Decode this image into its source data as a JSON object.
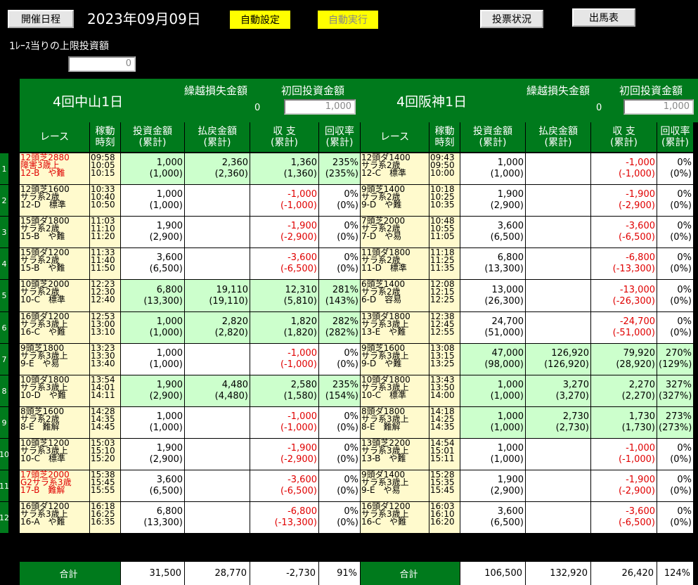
{
  "toolbar": {
    "schedule_btn": "開催日程",
    "date": "2023年09月09日",
    "auto_set": "自動設定",
    "auto_run": "自動実行",
    "vote_status": "投票状況",
    "entries": "出馬表"
  },
  "limit": {
    "label": "1ﾚｰｽ当りの上限投資額",
    "value": "0"
  },
  "venues": [
    {
      "name": "4回中山1日",
      "carry_label": "繰越損失金額",
      "carry_value": "0",
      "init_label": "初回投資金額",
      "init_value": "1,000"
    },
    {
      "name": "4回阪神1日",
      "carry_label": "繰越損失金額",
      "carry_value": "0",
      "init_label": "初回投資金額",
      "init_value": "1,000"
    }
  ],
  "columns": {
    "race": "レース",
    "time1": "稼動",
    "time2": "時刻",
    "inv1": "投資金額",
    "inv2": "(累計)",
    "pay1": "払戻金額",
    "pay2": "(累計)",
    "bal1": "収 支",
    "bal2": "(累計)",
    "rate1": "回収率",
    "rate2": "(累計)"
  },
  "rows": [
    {
      "n": "1",
      "v": [
        {
          "red": true,
          "race": [
            "12頭芝2880",
            "障害3歳上",
            "12-B　や難"
          ],
          "time": [
            "09:58",
            "10:05",
            "10:15"
          ],
          "hl": true,
          "inv": [
            "1,000",
            "(1,000)"
          ],
          "pay": [
            "2,360",
            "(2,360)"
          ],
          "bal": [
            "1,360",
            "(1,360)"
          ],
          "rate": [
            "235%",
            "(235%)"
          ],
          "neg": false
        },
        {
          "red": false,
          "race": [
            "12頭ダ1400",
            "サラ系2歳",
            "12-C　標準"
          ],
          "time": [
            "09:43",
            "09:50",
            "10:00"
          ],
          "hl": false,
          "inv": [
            "1,000",
            "(1,000)"
          ],
          "pay": [
            "",
            ""
          ],
          "bal": [
            "-1,000",
            "(-1,000)"
          ],
          "rate": [
            "0%",
            "(0%)"
          ],
          "neg": true
        }
      ]
    },
    {
      "n": "2",
      "v": [
        {
          "red": false,
          "race": [
            "12頭芝1600",
            "サラ系2歳",
            "12-D　標準"
          ],
          "time": [
            "10:33",
            "10:40",
            "10:50"
          ],
          "hl": false,
          "inv": [
            "1,000",
            "(1,000)"
          ],
          "pay": [
            "",
            ""
          ],
          "bal": [
            "-1,000",
            "(-1,000)"
          ],
          "rate": [
            "0%",
            "(0%)"
          ],
          "neg": true
        },
        {
          "red": false,
          "race": [
            "9頭芝1400",
            "サラ系2歳",
            "9-D　や難"
          ],
          "time": [
            "10:18",
            "10:25",
            "10:35"
          ],
          "hl": false,
          "inv": [
            "1,900",
            "(2,900)"
          ],
          "pay": [
            "",
            ""
          ],
          "bal": [
            "-1,900",
            "(-2,900)"
          ],
          "rate": [
            "0%",
            "(0%)"
          ],
          "neg": true
        }
      ]
    },
    {
      "n": "3",
      "v": [
        {
          "red": false,
          "race": [
            "15頭ダ1800",
            "サラ系2歳",
            "15-B　や難"
          ],
          "time": [
            "11:03",
            "11:10",
            "11:20"
          ],
          "hl": false,
          "inv": [
            "1,900",
            "(2,900)"
          ],
          "pay": [
            "",
            ""
          ],
          "bal": [
            "-1,900",
            "(-2,900)"
          ],
          "rate": [
            "0%",
            "(0%)"
          ],
          "neg": true
        },
        {
          "red": false,
          "race": [
            "7頭芝2000",
            "サラ系2歳",
            "7-D　や易"
          ],
          "time": [
            "10:48",
            "10:55",
            "11:05"
          ],
          "hl": false,
          "inv": [
            "3,600",
            "(6,500)"
          ],
          "pay": [
            "",
            ""
          ],
          "bal": [
            "-3,600",
            "(-6,500)"
          ],
          "rate": [
            "0%",
            "(0%)"
          ],
          "neg": true
        }
      ]
    },
    {
      "n": "4",
      "v": [
        {
          "red": false,
          "race": [
            "15頭ダ1200",
            "サラ系2歳",
            "15-B　や難"
          ],
          "time": [
            "11:33",
            "11:40",
            "11:50"
          ],
          "hl": false,
          "inv": [
            "3,600",
            "(6,500)"
          ],
          "pay": [
            "",
            ""
          ],
          "bal": [
            "-3,600",
            "(-6,500)"
          ],
          "rate": [
            "0%",
            "(0%)"
          ],
          "neg": true
        },
        {
          "red": false,
          "race": [
            "11頭ダ1800",
            "サラ系2歳",
            "11-D　標準"
          ],
          "time": [
            "11:18",
            "11:25",
            "11:35"
          ],
          "hl": false,
          "inv": [
            "6,800",
            "(13,300)"
          ],
          "pay": [
            "",
            ""
          ],
          "bal": [
            "-6,800",
            "(-13,300)"
          ],
          "rate": [
            "0%",
            "(0%)"
          ],
          "neg": true
        }
      ]
    },
    {
      "n": "5",
      "v": [
        {
          "red": false,
          "race": [
            "10頭芝2000",
            "サラ系2歳",
            "10-C　標準"
          ],
          "time": [
            "12:23",
            "12:30",
            "12:40"
          ],
          "hl": true,
          "inv": [
            "6,800",
            "(13,300)"
          ],
          "pay": [
            "19,110",
            "(19,110)"
          ],
          "bal": [
            "12,310",
            "(5,810)"
          ],
          "rate": [
            "281%",
            "(143%)"
          ],
          "neg": false
        },
        {
          "red": false,
          "race": [
            "6頭芝1400",
            "サラ系2歳",
            "6-D　容易"
          ],
          "time": [
            "12:08",
            "12:15",
            "12:25"
          ],
          "hl": false,
          "inv": [
            "13,000",
            "(26,300)"
          ],
          "pay": [
            "",
            ""
          ],
          "bal": [
            "-13,000",
            "(-26,300)"
          ],
          "rate": [
            "0%",
            "(0%)"
          ],
          "neg": true
        }
      ]
    },
    {
      "n": "6",
      "v": [
        {
          "red": false,
          "race": [
            "16頭ダ1200",
            "サラ系3歳上",
            "16-C　や難"
          ],
          "time": [
            "12:53",
            "13:00",
            "13:10"
          ],
          "hl": true,
          "inv": [
            "1,000",
            "(1,000)"
          ],
          "pay": [
            "2,820",
            "(2,820)"
          ],
          "bal": [
            "1,820",
            "(1,820)"
          ],
          "rate": [
            "282%",
            "(282%)"
          ],
          "neg": false
        },
        {
          "red": false,
          "race": [
            "13頭ダ1800",
            "サラ系3歳上",
            "13-E　や難"
          ],
          "time": [
            "12:38",
            "12:45",
            "12:55"
          ],
          "hl": false,
          "inv": [
            "24,700",
            "(51,000)"
          ],
          "pay": [
            "",
            ""
          ],
          "bal": [
            "-24,700",
            "(-51,000)"
          ],
          "rate": [
            "0%",
            "(0%)"
          ],
          "neg": true
        }
      ]
    },
    {
      "n": "7",
      "v": [
        {
          "red": false,
          "race": [
            "9頭芝1800",
            "サラ系3歳上",
            "9-E　や易"
          ],
          "time": [
            "13:23",
            "13:30",
            "13:40"
          ],
          "hl": false,
          "inv": [
            "1,000",
            "(1,000)"
          ],
          "pay": [
            "",
            ""
          ],
          "bal": [
            "-1,000",
            "(-1,000)"
          ],
          "rate": [
            "0%",
            "(0%)"
          ],
          "neg": true
        },
        {
          "red": false,
          "race": [
            "9頭芝1600",
            "サラ系3歳上",
            "9-D　や難"
          ],
          "time": [
            "13:08",
            "13:15",
            "13:25"
          ],
          "hl": true,
          "inv": [
            "47,000",
            "(98,000)"
          ],
          "pay": [
            "126,920",
            "(126,920)"
          ],
          "bal": [
            "79,920",
            "(28,920)"
          ],
          "rate": [
            "270%",
            "(129%)"
          ],
          "neg": false
        }
      ]
    },
    {
      "n": "8",
      "v": [
        {
          "red": false,
          "race": [
            "10頭ダ1800",
            "サラ系3歳上",
            "10-D　や難"
          ],
          "time": [
            "13:54",
            "14:01",
            "14:11"
          ],
          "hl": true,
          "inv": [
            "1,900",
            "(2,900)"
          ],
          "pay": [
            "4,480",
            "(4,480)"
          ],
          "bal": [
            "2,580",
            "(1,580)"
          ],
          "rate": [
            "235%",
            "(154%)"
          ],
          "neg": false
        },
        {
          "red": false,
          "race": [
            "10頭ダ1800",
            "サラ系3歳上",
            "10-C　標準"
          ],
          "time": [
            "13:43",
            "13:50",
            "14:00"
          ],
          "hl": true,
          "inv": [
            "1,000",
            "(1,000)"
          ],
          "pay": [
            "3,270",
            "(3,270)"
          ],
          "bal": [
            "2,270",
            "(2,270)"
          ],
          "rate": [
            "327%",
            "(327%)"
          ],
          "neg": false
        }
      ]
    },
    {
      "n": "9",
      "v": [
        {
          "red": false,
          "race": [
            "8頭芝1600",
            "サラ系2歳",
            "8-E　難解"
          ],
          "time": [
            "14:28",
            "14:35",
            "14:45"
          ],
          "hl": false,
          "inv": [
            "1,000",
            "(1,000)"
          ],
          "pay": [
            "",
            ""
          ],
          "bal": [
            "-1,000",
            "(-1,000)"
          ],
          "rate": [
            "0%",
            "(0%)"
          ],
          "neg": true
        },
        {
          "red": false,
          "race": [
            "8頭ダ1800",
            "サラ系3歳上",
            "8-E　難解"
          ],
          "time": [
            "14:18",
            "14:25",
            "14:35"
          ],
          "hl": true,
          "inv": [
            "1,000",
            "(1,000)"
          ],
          "pay": [
            "2,730",
            "(2,730)"
          ],
          "bal": [
            "1,730",
            "(1,730)"
          ],
          "rate": [
            "273%",
            "(273%)"
          ],
          "neg": false
        }
      ]
    },
    {
      "n": "10",
      "v": [
        {
          "red": false,
          "race": [
            "10頭芝1200",
            "サラ系3歳上",
            "10-C　標準"
          ],
          "time": [
            "15:03",
            "15:10",
            "15:20"
          ],
          "hl": false,
          "inv": [
            "1,900",
            "(2,900)"
          ],
          "pay": [
            "",
            ""
          ],
          "bal": [
            "-1,900",
            "(-2,900)"
          ],
          "rate": [
            "0%",
            "(0%)"
          ],
          "neg": true
        },
        {
          "red": false,
          "race": [
            "13頭芝2200",
            "サラ系3歳上",
            "13-B　や難"
          ],
          "time": [
            "14:54",
            "15:01",
            "15:11"
          ],
          "hl": false,
          "inv": [
            "1,000",
            "(1,000)"
          ],
          "pay": [
            "",
            ""
          ],
          "bal": [
            "-1,000",
            "(-1,000)"
          ],
          "rate": [
            "0%",
            "(0%)"
          ],
          "neg": true
        }
      ]
    },
    {
      "n": "11",
      "v": [
        {
          "red": true,
          "race": [
            "17頭芝2000",
            "G2サラ系3歳",
            "17-B　難解"
          ],
          "time": [
            "15:38",
            "15:45",
            "15:55"
          ],
          "hl": false,
          "inv": [
            "3,600",
            "(6,500)"
          ],
          "pay": [
            "",
            ""
          ],
          "bal": [
            "-3,600",
            "(-6,500)"
          ],
          "rate": [
            "0%",
            "(0%)"
          ],
          "neg": true
        },
        {
          "red": false,
          "race": [
            "9頭ダ1400",
            "サラ系3歳上",
            "9-E　や易"
          ],
          "time": [
            "15:28",
            "15:35",
            "15:45"
          ],
          "hl": false,
          "inv": [
            "1,900",
            "(2,900)"
          ],
          "pay": [
            "",
            ""
          ],
          "bal": [
            "-1,900",
            "(-2,900)"
          ],
          "rate": [
            "0%",
            "(0%)"
          ],
          "neg": true
        }
      ]
    },
    {
      "n": "12",
      "v": [
        {
          "red": false,
          "race": [
            "16頭ダ1200",
            "サラ系3歳上",
            "16-A　や難"
          ],
          "time": [
            "16:18",
            "16:25",
            "16:35"
          ],
          "hl": false,
          "inv": [
            "6,800",
            "(13,300)"
          ],
          "pay": [
            "",
            ""
          ],
          "bal": [
            "-6,800",
            "(-13,300)"
          ],
          "rate": [
            "0%",
            "(0%)"
          ],
          "neg": true
        },
        {
          "red": false,
          "race": [
            "16頭ダ1200",
            "サラ系3歳上",
            "16-C　や難"
          ],
          "time": [
            "16:03",
            "16:10",
            "16:20"
          ],
          "hl": false,
          "inv": [
            "3,600",
            "(6,500)"
          ],
          "pay": [
            "",
            ""
          ],
          "bal": [
            "-3,600",
            "(-6,500)"
          ],
          "rate": [
            "0%",
            "(0%)"
          ],
          "neg": true
        }
      ]
    }
  ],
  "totals": [
    {
      "label": "合計",
      "inv": "31,500",
      "pay": "28,770",
      "bal": "-2,730",
      "rate": "91%"
    },
    {
      "label": "合計",
      "inv": "106,500",
      "pay": "132,920",
      "bal": "26,420",
      "rate": "124%"
    }
  ],
  "colors": {
    "header_green": "#007a1c",
    "race_yellow": "#fffacd",
    "win_green": "#ccffcc",
    "loss_red": "#e00000"
  }
}
